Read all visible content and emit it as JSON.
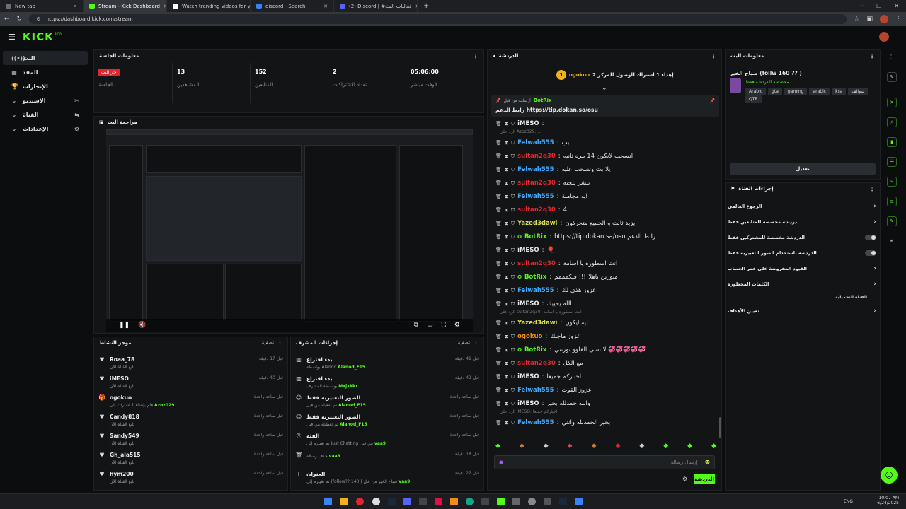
{
  "browser": {
    "tabs": [
      {
        "title": "New tab",
        "color": "#6b6f75"
      },
      {
        "title": "Stream - Kick Dashboard",
        "color": "#53fc18"
      },
      {
        "title": "Watch trending videos for you | T",
        "color": "#1f1f1f"
      },
      {
        "title": "discord - Search",
        "color": "#3b82f6"
      },
      {
        "title": "(2) Discord | #فعاليات-البث",
        "color": "#5865f2"
      }
    ],
    "url": "https://dashboard.kick.com/stream"
  },
  "app": {
    "logo": "KICK",
    "logo_suffix": "BETA"
  },
  "sidebar": {
    "items": [
      {
        "label": "البث",
        "icon": "stream-icon"
      },
      {
        "label": "المقد",
        "icon": "content-icon"
      },
      {
        "label": "الإنجازات",
        "icon": "trophy-icon"
      },
      {
        "label": "الاستديو",
        "icon": "studio-icon"
      },
      {
        "label": "القناة",
        "icon": "channel-icon"
      },
      {
        "label": "الإعدادات",
        "icon": "settings-icon"
      }
    ]
  },
  "session": {
    "title": "معلومات الجلسة",
    "live_badge": "جار البث",
    "live_label": "الجلسة",
    "stats": [
      {
        "value": "13",
        "label": "المشاهدين"
      },
      {
        "value": "152",
        "label": "المتابعين"
      },
      {
        "value": "2",
        "label": "تعداد الاشتراكات"
      },
      {
        "value": "05:06:00",
        "label": "الوقت مباشر"
      }
    ]
  },
  "preview": {
    "title": "مراجعة البث"
  },
  "activity": {
    "title": "موجز النشاط",
    "filter": "تصفية",
    "rows": [
      {
        "name": "Roaa_78",
        "desc": "تابع القناة الآن",
        "time": "قبل 17 دقيقة",
        "color": "#e8e8e8"
      },
      {
        "name": "iMESO",
        "desc": "تابع القناة الآن",
        "time": "قبل 40 دقيقة",
        "color": "#e8e8e8"
      },
      {
        "name": "ogokuo",
        "desc": "قام بإهداء 1 اشتراك إلى",
        "extra": "Azoz029",
        "time": "قبل ساعة واحدة",
        "color": "#e8e8e8"
      },
      {
        "name": "Candy818",
        "desc": "تابع القناة الآن",
        "time": "قبل ساعة واحدة",
        "color": "#e8e8e8"
      },
      {
        "name": "Sandy549",
        "desc": "تابع القناة الآن",
        "time": "قبل ساعة واحدة",
        "color": "#e8e8e8"
      },
      {
        "name": "Gh_ala515",
        "desc": "تابع القناة الآن",
        "time": "قبل ساعة واحدة",
        "color": "#e8e8e8"
      },
      {
        "name": "hym200",
        "desc": "تابع القناة الآن",
        "time": "قبل ساعة واحدة",
        "color": "#e8e8e8"
      }
    ]
  },
  "moderation": {
    "title": "إجراءات المشرف",
    "filter": "تصفية",
    "rows": [
      {
        "name": "Alanod_F15",
        "action": "بدء اقتراع",
        "desc": "بواسطة Alanod",
        "time": "قبل 41 دقيقة"
      },
      {
        "name": "Mxjxkkx",
        "action": "بدء اقتراع",
        "desc": "بواسطة المشرف",
        "time": "قبل 42 دقيقة"
      },
      {
        "name": "Alanod_F15",
        "action": "الصور التعبيرية فقط",
        "desc": "تم تفعيله من قبل",
        "time": "قبل ساعة واحدة"
      },
      {
        "name": "Alanod_F15",
        "action": "الصور التعبيرية فقط",
        "desc": "تم تعطيله من قبل",
        "time": "قبل ساعة واحدة"
      },
      {
        "name": "vaa9",
        "action": "الفئة",
        "desc": "تم تغييره إلى Just Chatting من قبل",
        "time": "قبل ساعة واحدة"
      },
      {
        "name": "vaa9",
        "action": "",
        "desc": "حذف رسالة",
        "time": "قبل 18 دقيقة"
      },
      {
        "name": "vaa9",
        "action": "العنوان",
        "desc": "تم تغييره إلى (follow?? 140 ) صباح الخير من قبل",
        "time": "قبل 22 دقيقة"
      }
    ]
  },
  "chat": {
    "title": "الدردشة",
    "pinned_user": "ogokuo",
    "pinned_text": "إهداء 1 اشتراك للوصول للمركز 2",
    "pinned_rank": "1",
    "bot_name": "BotRix",
    "bot_pinned_by": "أرسلت من قبل",
    "bot_text": "رابط الدعم https://tip.dokan.sa/osu",
    "messages": [
      {
        "user": "iMESO",
        "color": "#e8e8e8",
        "text": ""
      },
      {
        "user": "Felwah555",
        "color": "#3fa7ff",
        "text": "بب"
      },
      {
        "user": "sultan2q30",
        "color": "#e0262f",
        "text": "انسحب لانكون 14 مره ثانيه"
      },
      {
        "user": "Felwah555",
        "color": "#3fa7ff",
        "text": "يلا بث ونسحب عليه"
      },
      {
        "user": "sultan2q30",
        "color": "#e0262f",
        "text": "تبشر يلحنه"
      },
      {
        "user": "Felwah555",
        "color": "#3fa7ff",
        "text": "ايه مجاملة"
      },
      {
        "user": "sultan2q30",
        "color": "#e0262f",
        "text": "4"
      },
      {
        "user": "Yazed3dawi",
        "color": "#d7e04b",
        "text": "يزيد ثابت و الجميع متحركون"
      },
      {
        "user": "BotRix",
        "color": "#53fc18",
        "text": "https://tip.dokan.sa/osu رابط الدعم"
      },
      {
        "user": "iMESO",
        "color": "#e8e8e8",
        "text": "🎈"
      },
      {
        "user": "sultan2q30",
        "color": "#e0262f",
        "text": "انت اسطوره يا اسامة"
      },
      {
        "user": "BotRix",
        "color": "#53fc18",
        "text": "منورين ياهلا!!!! فيكمممم"
      },
      {
        "user": "Felwah555",
        "color": "#3fa7ff",
        "text": "عزوز هذي لك"
      },
      {
        "user": "iMESO",
        "color": "#e8e8e8",
        "text": "الله يحييك"
      },
      {
        "user": "Yazed3dawi",
        "color": "#d7e04b",
        "text": "ليه ايكون"
      },
      {
        "user": "ogokuo",
        "color": "#f08c1a",
        "text": "عزوز ماجبك"
      },
      {
        "user": "BotRix",
        "color": "#53fc18",
        "text": "لاتنسى الفلوو نورتني 💞💞💞💞💞"
      },
      {
        "user": "sultan2q30",
        "color": "#e0262f",
        "text": "مع الكل"
      },
      {
        "user": "iMESO",
        "color": "#e8e8e8",
        "text": "اخباركم جميعا"
      },
      {
        "user": "Felwah555",
        "color": "#3fa7ff",
        "text": "عزوز القوت"
      },
      {
        "user": "iMESO",
        "color": "#e8e8e8",
        "text": "والله حمدلله بخير"
      },
      {
        "user": "Felwah555",
        "color": "#3fa7ff",
        "text": "بخير الحمدلله وانتي"
      }
    ],
    "reply_notes": [
      {
        "after": 0,
        "text": "الرد على Azoz029: ..."
      },
      {
        "after": 13,
        "text": "الرد على sultan2q30: انت اسطوره يا اسامة"
      },
      {
        "after": 20,
        "text": "الرد على iMESO: اخباركم جميعا"
      }
    ],
    "input_placeholder": "إرسال رسالة",
    "send_button": "الدردشة"
  },
  "stream_info": {
    "title": "معلومات البث",
    "stream_title": "صباح الخير (follw 160 ?? )",
    "category": "مخصصة للدردشة فقط",
    "tags": [
      "Arabic",
      "gta",
      "gaming",
      "arabic",
      "ksa",
      "سوالف",
      "QTR"
    ],
    "edit_button": "تعديل"
  },
  "channel_actions": {
    "title": "إجراءات القناة",
    "items": [
      {
        "label": "الرجوع العالمي",
        "kind": "chevron"
      },
      {
        "label": "دردشة مخصصة للمتابعين فقط",
        "kind": "chevron"
      },
      {
        "label": "الدردشة مخصصة للمشتركين فقط",
        "kind": "toggle"
      },
      {
        "label": "الدردشة باستخدام الصور التعبيرية فقط",
        "kind": "toggle"
      },
      {
        "label": "القيود المفروضة على عمر الحساب",
        "kind": "chevron"
      },
      {
        "label": "الكلمات المحظورة",
        "kind": "chevron"
      }
    ],
    "subhead": "القناة التحميلية",
    "goals_label": "تعيين الأهداف"
  },
  "taskbar": {
    "lang": "ENG",
    "time": "10:07 AM",
    "date": "6/24/2025"
  },
  "colors": {
    "accent": "#53fc18",
    "bg": "#0b0d0f",
    "panel": "#121416",
    "live": "#e0262f"
  }
}
